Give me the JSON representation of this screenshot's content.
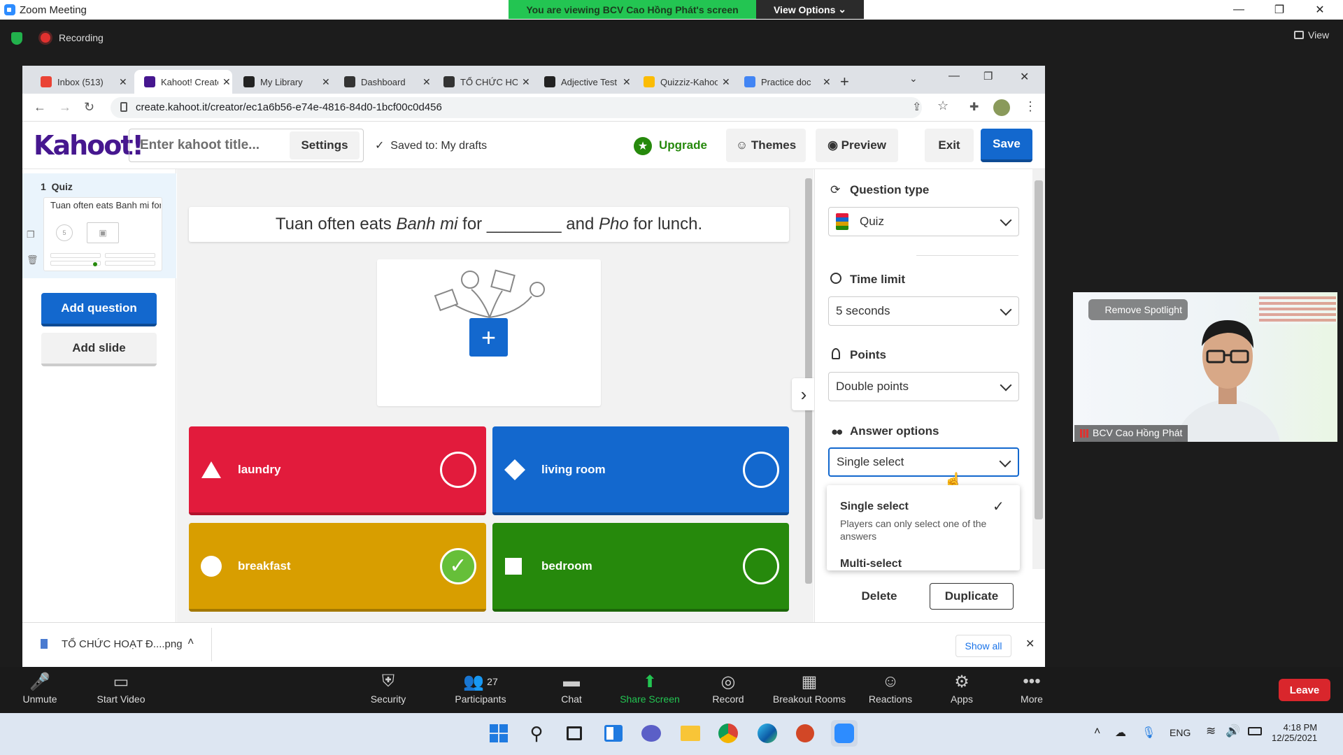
{
  "zoom": {
    "window_title": "Zoom Meeting",
    "viewing_banner": "You are viewing BCV Cao Hồng Phát's screen",
    "view_options": "View Options",
    "recording": "Recording",
    "view": "View",
    "leave": "Leave",
    "toolbar": [
      {
        "label": "Unmute"
      },
      {
        "label": "Start Video"
      },
      {
        "label": "Security"
      },
      {
        "label": "Participants",
        "count": "27"
      },
      {
        "label": "Chat"
      },
      {
        "label": "Share Screen"
      },
      {
        "label": "Record"
      },
      {
        "label": "Breakout Rooms"
      },
      {
        "label": "Reactions"
      },
      {
        "label": "Apps"
      },
      {
        "label": "More"
      }
    ],
    "video": {
      "remove_spotlight": "Remove Spotlight",
      "participant_name": "BCV Cao Hồng Phát"
    }
  },
  "browser": {
    "tabs": [
      {
        "label": "Inbox (513)",
        "color": "#ea4335"
      },
      {
        "label": "Kahoot! Creator",
        "color": "#46178f",
        "active": true
      },
      {
        "label": "My Library",
        "color": "#222"
      },
      {
        "label": "Dashboard",
        "color": "#333"
      },
      {
        "label": "TỔ CHỨC HOẠT",
        "color": "#333"
      },
      {
        "label": "Adjective Test",
        "color": "#222"
      },
      {
        "label": "Quizziz-Kahoot",
        "color": "#fbbc04"
      },
      {
        "label": "Practice doc",
        "color": "#4285f4"
      }
    ],
    "url": "create.kahoot.it/creator/ec1a6b56-e74e-4816-84d0-1bcf00c0d456"
  },
  "kahoot": {
    "logo": "Kahoot!",
    "title_placeholder": "Enter kahoot title...",
    "settings": "Settings",
    "saved": "Saved to: My drafts",
    "upgrade": "Upgrade",
    "themes": "Themes",
    "preview": "Preview",
    "exit": "Exit",
    "save": "Save",
    "sidebar": {
      "slide_number": "1",
      "slide_type": "Quiz",
      "slide_preview": "Tuan often eats Banh mi for",
      "time_badge": "5",
      "add_question": "Add question",
      "add_slide": "Add slide"
    },
    "question": {
      "part1": "Tuan often eats ",
      "em1": "Banh mi",
      "part2": " for ",
      "blank": "________",
      "part3": " and ",
      "em2": "Pho",
      "part4": " for lunch."
    },
    "answers": [
      {
        "text": "laundry",
        "color": "#e21b3c",
        "shape": "triangle",
        "correct": false
      },
      {
        "text": "living room",
        "color": "#1368ce",
        "shape": "diamond",
        "correct": false
      },
      {
        "text": "breakfast",
        "color": "#d89e00",
        "shape": "circle",
        "correct": true
      },
      {
        "text": "bedroom",
        "color": "#26890c",
        "shape": "square",
        "correct": false
      }
    ],
    "panel": {
      "question_type_label": "Question type",
      "question_type": "Quiz",
      "time_limit_label": "Time limit",
      "time_limit": "5 seconds",
      "points_label": "Points",
      "points": "Double points",
      "answer_options_label": "Answer options",
      "answer_options": "Single select",
      "dropdown": [
        {
          "title": "Single select",
          "desc": "Players can only select one of the answers",
          "selected": true
        },
        {
          "title": "Multi-select"
        }
      ],
      "delete": "Delete",
      "duplicate": "Duplicate"
    }
  },
  "downloads": {
    "file": "TỔ CHỨC HOẠT Đ....png",
    "show_all": "Show all"
  },
  "taskbar": {
    "lang": "ENG",
    "time": "4:18 PM",
    "date": "12/25/2021"
  }
}
